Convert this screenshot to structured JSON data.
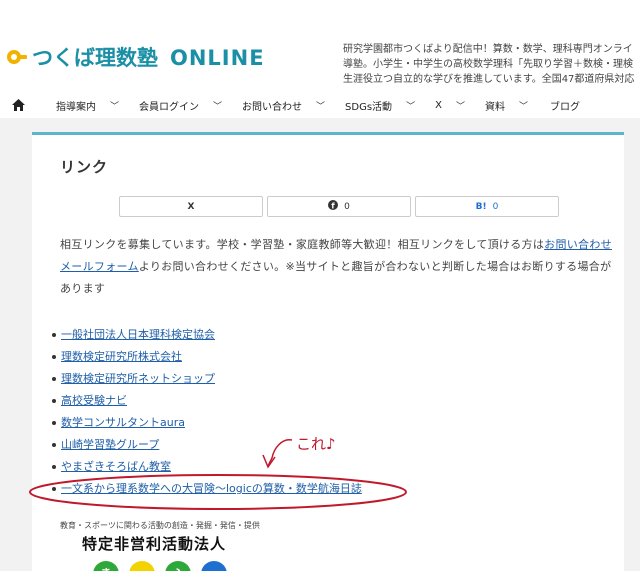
{
  "header": {
    "logo_text": "つくば理数塾",
    "logo_suffix": "ONLINE",
    "tagline_lines": [
      "研究学園都市つくばより配信中！算数・数学、理科専門オンライ",
      "導塾。小学生・中学生の高校数学理科「先取り学習＋数検・理検",
      "生涯役立つ自立的な学びを推進しています。全国47都道府県対応"
    ],
    "brand_color": "#1a8fa6",
    "accent_color": "#f2b300"
  },
  "nav": {
    "home_icon": "home-icon",
    "items": [
      {
        "label": "指導案内",
        "has_dropdown": true
      },
      {
        "label": "会員ログイン",
        "has_dropdown": true
      },
      {
        "label": "お問い合わせ",
        "has_dropdown": true
      },
      {
        "label": "SDGs活動",
        "has_dropdown": true
      },
      {
        "label": "X",
        "has_dropdown": true
      },
      {
        "label": "資料",
        "has_dropdown": true
      },
      {
        "label": "ブログ",
        "has_dropdown": false
      }
    ]
  },
  "page": {
    "title": "リンク",
    "share": [
      {
        "icon": "x-icon",
        "label": "X",
        "count": ""
      },
      {
        "icon": "facebook-icon",
        "label": "",
        "count": "0"
      },
      {
        "icon": "hatena-bookmark-icon",
        "label": "B!",
        "count": "0"
      }
    ],
    "intro_before_link": "相互リンクを募集しています。学校・学習塾・家庭教師等大歓迎！相互リンクをして頂ける方は",
    "intro_link": "お問い合わせメールフォーム",
    "intro_after_link": "よりお問い合わせください。※当サイトと趣旨が合わないと判断した場合はお断りする場合があります",
    "links": [
      "一般社団法人日本理科検定協会",
      "理数検定研究所株式会社",
      "理数検定研究所ネットショップ",
      "高校受験ナビ",
      "数学コンサルタントaura",
      "山崎学習塾グループ",
      "やまざきそろばん教室",
      "一文系から理系数学への大冒険〜logicの算数・数学航海日誌"
    ],
    "annotation_text": "これ♪",
    "annotation_color": "#c0192c",
    "sub_caption": "教育・スポーツに関わる活動の創造・発掘・発信・提供",
    "org_heading": "特定非営利活動法人",
    "circle_colors": [
      "#2fa83a",
      "#f2d300",
      "#2fa83a",
      "#1f6fd1"
    ],
    "circle_letters": [
      "き",
      "",
      "ふ",
      ""
    ]
  }
}
